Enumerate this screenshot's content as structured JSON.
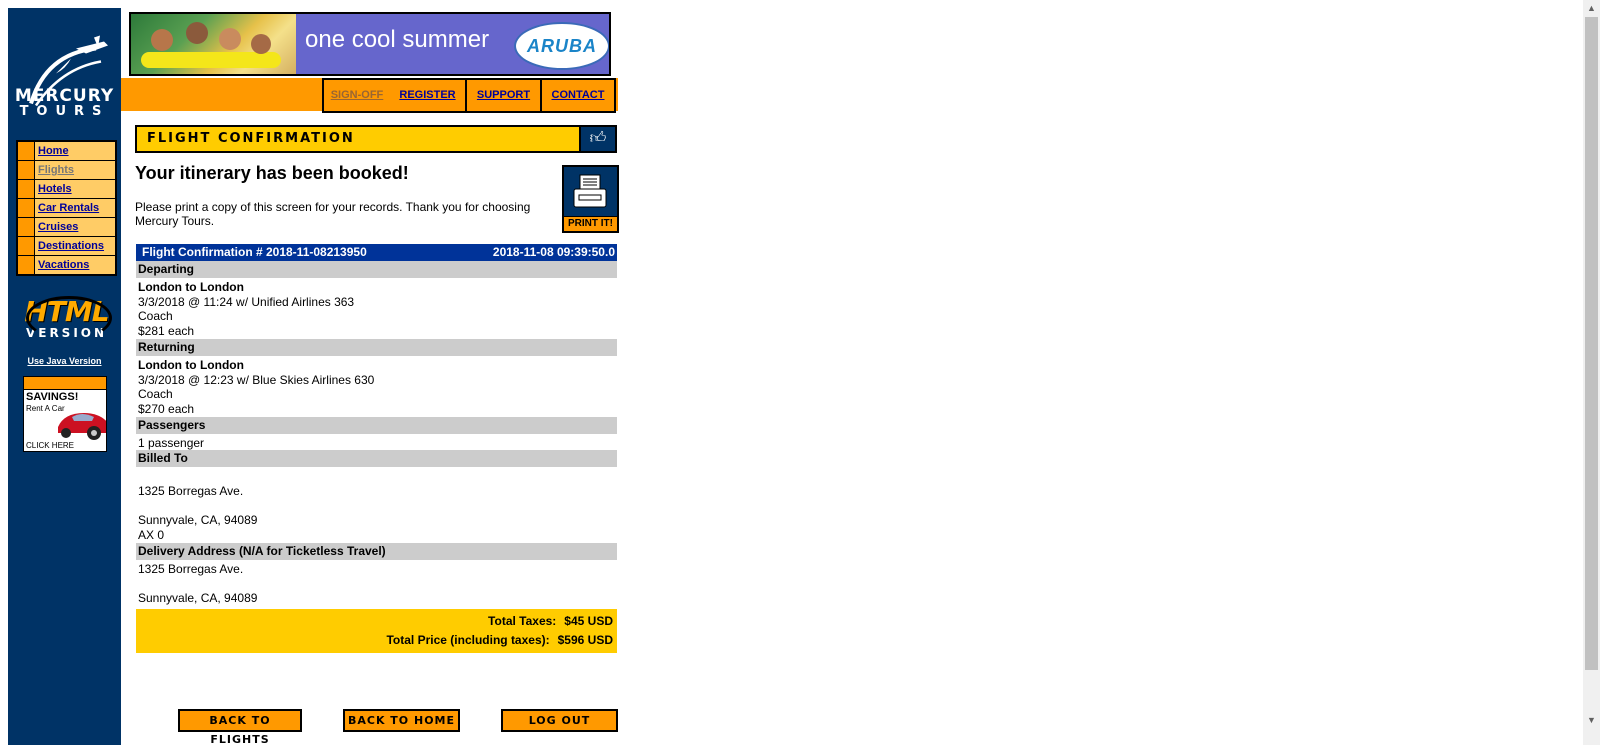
{
  "logo": {
    "line1": "MERCURY",
    "line2": "TOURS"
  },
  "sidebar": {
    "items": [
      {
        "label": "Home",
        "visited": false
      },
      {
        "label": "Flights",
        "visited": true
      },
      {
        "label": "Hotels",
        "visited": false
      },
      {
        "label": "Car Rentals",
        "visited": false
      },
      {
        "label": "Cruises",
        "visited": false
      },
      {
        "label": "Destinations",
        "visited": false
      },
      {
        "label": "Vacations",
        "visited": false
      }
    ],
    "html_version": {
      "big": "HTML",
      "small": "VERSION"
    },
    "java_link": "Use Java Version",
    "ad": {
      "headline": "SAVINGS!",
      "sub": "Rent A Car",
      "cta": "CLICK HERE"
    }
  },
  "banner": {
    "slogan": "one cool summer",
    "brand": "ARUBA"
  },
  "topnav": {
    "signoff": "SIGN-OFF",
    "register": "REGISTER",
    "support": "SUPPORT",
    "contact": "CONTACT"
  },
  "main": {
    "title": "FLIGHT CONFIRMATION",
    "booked": "Your itinerary has been booked!",
    "instructions": "Please print a copy of this screen for your records. Thank you for choosing Mercury Tours.",
    "print_label": "PRINT IT!",
    "confirmation": {
      "number_label": "Flight Confirmation # 2018-11-08213950",
      "timestamp": "2018-11-08 09:39:50.0"
    },
    "departing": {
      "heading": "Departing",
      "route": "London to London",
      "flight": "3/3/2018 @ 11:24 w/ Unified Airlines 363",
      "class": "Coach",
      "price": "$281 each"
    },
    "returning": {
      "heading": "Returning",
      "route": "London to London",
      "flight": "3/3/2018 @ 12:23 w/ Blue Skies Airlines 630",
      "class": "Coach",
      "price": "$270 each"
    },
    "passengers": {
      "heading": "Passengers",
      "value": "1 passenger"
    },
    "billed": {
      "heading": "Billed To",
      "street": "1325 Borregas Ave.",
      "city": "Sunnyvale, CA, 94089",
      "card": "AX 0"
    },
    "delivery": {
      "heading": "Delivery Address (N/A for Ticketless Travel)",
      "street": "1325 Borregas Ave.",
      "city": "Sunnyvale, CA, 94089"
    },
    "totals": {
      "taxes_label": "Total Taxes:",
      "taxes_value": "$45 USD",
      "price_label": "Total Price (including taxes):",
      "price_value": "$596 USD"
    }
  },
  "buttons": {
    "back_flights": "BACK TO FLIGHTS",
    "back_home": "BACK TO HOME",
    "logout": "LOG OUT"
  },
  "colors": {
    "navy": "#003366",
    "orange": "#ff9900",
    "yellow": "#ffcc00",
    "conf_blue": "#003399"
  }
}
